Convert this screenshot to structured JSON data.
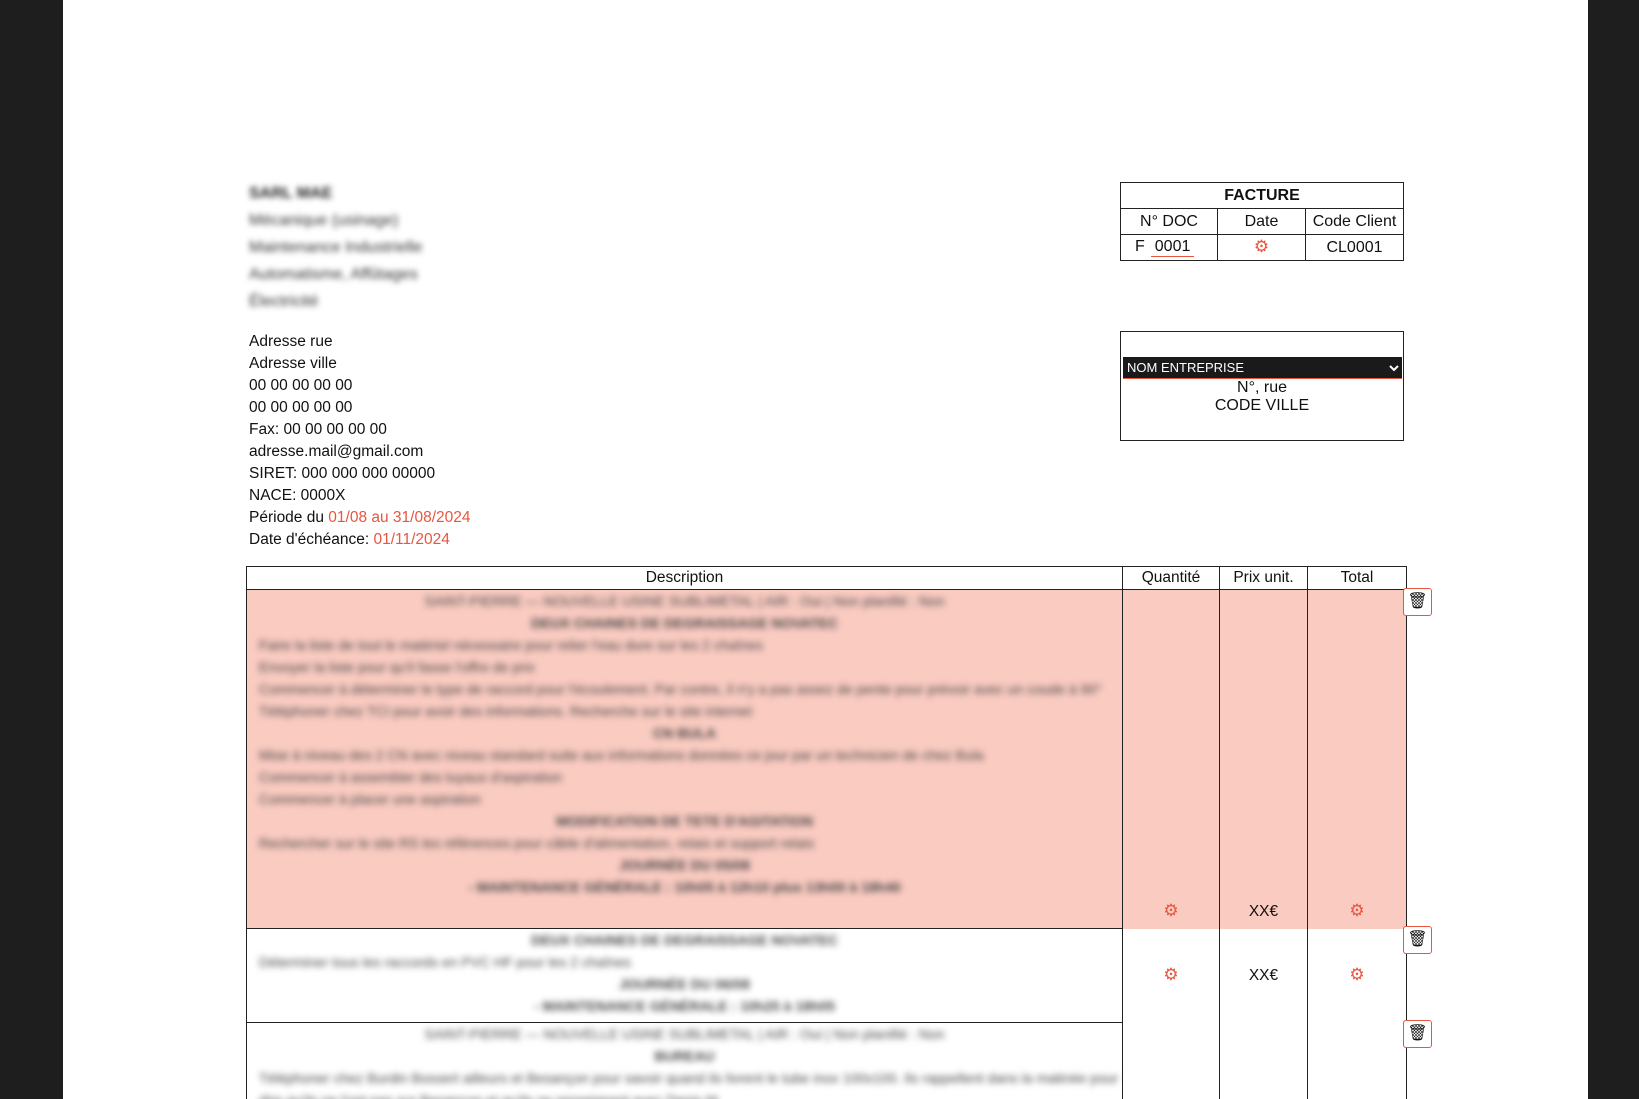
{
  "company": {
    "name": "SARL MAE",
    "activities": [
      "Mécanique (usinage)",
      "Maintenance Industrielle",
      "Automatisme, Affûtages",
      "Électricité"
    ]
  },
  "address": {
    "street": "Adresse rue",
    "city": "Adresse ville",
    "phone1": "00 00 00 00 00",
    "phone2": "00 00 00 00 00",
    "fax": "Fax: 00 00 00 00 00",
    "email": "adresse.mail@gmail.com",
    "siret": "SIRET: 000 000 000 00000",
    "nace": "NACE: 0000X",
    "period_label": "Période du ",
    "period_value": "01/08 au 31/08/2024",
    "due_label": "Date d'échéance: ",
    "due_value": "01/11/2024"
  },
  "facture": {
    "title": "FACTURE",
    "col_doc": "N° DOC",
    "col_date": "Date",
    "col_client": "Code Client",
    "doc_prefix": "F",
    "doc_number": "0001",
    "client_code": "CL0001"
  },
  "client": {
    "selected": "NOM ENTREPRISE",
    "street": "N°, rue",
    "city": "CODE VILLE"
  },
  "items": {
    "headers": {
      "description": "Description",
      "quantity": "Quantité",
      "unit_price": "Prix unit.",
      "total": "Total"
    },
    "rows": [
      {
        "prix": "XX€",
        "lines": [
          "SAINT-PIERRE — NOUVELLE USINE SUBLIMETAL | AIR : Oui | Non planifié : Non",
          "DEUX CHAINES DE DEGRAISSAGE NOVATEC",
          "Faire la liste de tout le matériel nécessaire pour relier l'eau dure sur les 2 chaînes",
          "Envoyer la liste pour qu'il fasse l'offre de prix",
          "Commencer à déterminer le type de raccord pour l'écoulement. Par contre, il n'y a pas assez de pente pour prévoir avec un coude à 90°",
          "Téléphoner chez TCI pour avoir des informations. Recherche sur le site internet",
          "CN BULA",
          "Mise à niveau des 2 CN avec niveau standard suite aux informations données ce jour par un technicien de chez Bula",
          "Commencer à assembler des tuyaux d'aspiration",
          "Commencer à placer une aspiration",
          "MODIFICATION DE TETE D'AGITATION",
          "Rechercher sur le site RS les références pour câble d'alimentation, relais et support relais",
          "JOURNÉE DU 05/08",
          "- MAINTENANCE GÉNÉRALE : 10h05 à 12h10 plus 13h00 à 18h40"
        ]
      },
      {
        "prix": "XX€",
        "lines": [
          "DEUX CHAINES DE DEGRAISSAGE NOVATEC",
          "Déterminer tous les raccords en PVC HF pour les 2 chaînes",
          "JOURNÉE DU 06/08",
          "- MAINTENANCE GÉNÉRALE : 10h25 à 18h05"
        ]
      },
      {
        "prix": "",
        "lines": [
          "SAINT-PIERRE — NOUVELLE USINE SUBLIMETAL | AIR : Oui | Non planifié : Non",
          "BUREAU",
          "Téléphoner chez Burdin Bossert ailleurs et Besançon pour savoir quand ils livrent le tube inox 100x100. Ils rappellent dans la matinée pour dire qu'ils ne l'ont pas sur Besançon et qu'ils se renseignent avec Denis M."
        ]
      }
    ]
  },
  "colors": {
    "accent": "#e8563f",
    "highlight_row": "#f9cbc1",
    "frame": "#1e1e1e"
  },
  "icons": {
    "date": "gear-icon",
    "quantity": "gear-icon",
    "total": "gear-icon",
    "delete": "trash-icon"
  }
}
